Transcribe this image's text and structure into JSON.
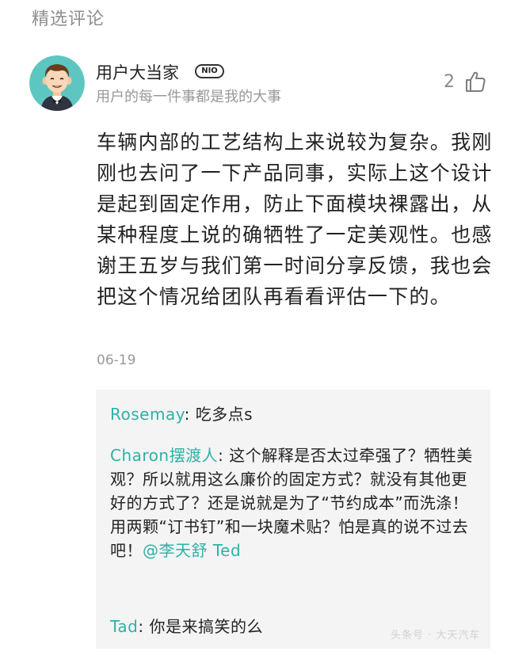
{
  "section": {
    "title": "精选评论"
  },
  "comment": {
    "author_name": "用户大当家",
    "badge": "NIO",
    "signature": "用户的每一件事都是我的大事",
    "like_count": "2",
    "body": "车辆内部的工艺结构上来说较为复杂。我刚刚也去问了一下产品同事，实际上这个设计是起到固定作用，防止下面模块裸露出，从某种程度上说的确牺牲了一定美观性。也感谢王五岁与我们第一时间分享反馈，我也会把这个情况给团队再看看评估一下的。",
    "date": "06-19"
  },
  "replies": [
    {
      "name": "Rosemay",
      "text": "吃多点s"
    },
    {
      "name": "Charon摆渡人",
      "text": "这个解释是否太过牵强了？牺牲美观？所以就用这么廉价的固定方式？就没有其他更好的方式了？还是说就是为了“节约成本”而洗涤！用两颗“订书钉”和一块魔术贴？怕是真的说不过去吧！",
      "mention": "@李天舒 Ted"
    },
    {
      "name": "Tad",
      "text": "你是来搞笑的么"
    }
  ],
  "watermark": "头条号 · 大天汽车",
  "colors": {
    "accent": "#2eb1a6",
    "avatar_bg": "#5ec6c1",
    "muted": "#999999",
    "reply_bg": "#f4f4f4"
  },
  "icons": {
    "like": "thumbs-up-icon",
    "avatar": "avatar-icon"
  }
}
